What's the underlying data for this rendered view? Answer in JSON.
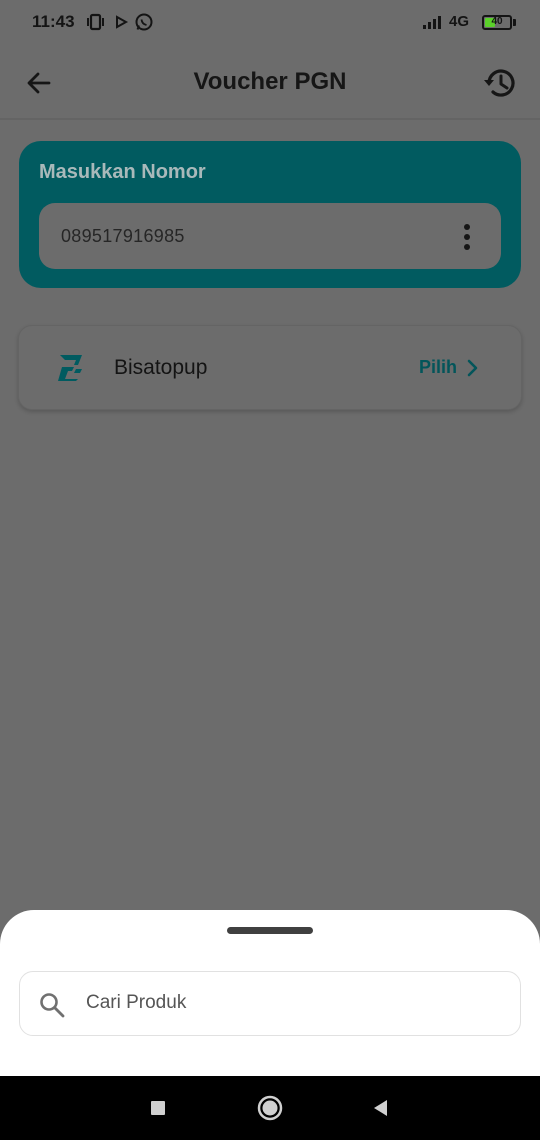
{
  "status_bar": {
    "time": "11:43",
    "network": "4G",
    "battery_level": "40",
    "battery_fraction": 0.4,
    "icons": [
      "vibrate-icon",
      "play-icon",
      "whatsapp-icon",
      "signal-icon",
      "battery-icon"
    ]
  },
  "header": {
    "title": "Voucher PGN",
    "back_icon": "arrow-left-icon",
    "history_icon": "history-icon"
  },
  "number_card": {
    "label": "Masukkan Nomor",
    "value": "089517916985",
    "more_icon": "more-vertical-icon"
  },
  "provider": {
    "name": "Bisatopup",
    "action": "Pilih",
    "logo_icon": "bisatopup-logo-icon",
    "chevron_icon": "chevron-right-icon"
  },
  "search": {
    "placeholder": "Cari Produk",
    "icon": "search-icon"
  },
  "nav": {
    "icons": [
      "recent-apps-icon",
      "home-icon",
      "back-icon"
    ]
  },
  "colors": {
    "accent": "#015b60",
    "accent_text": "#03555a",
    "scrim": "#6c6c6c",
    "battery": "#5bd12a"
  }
}
